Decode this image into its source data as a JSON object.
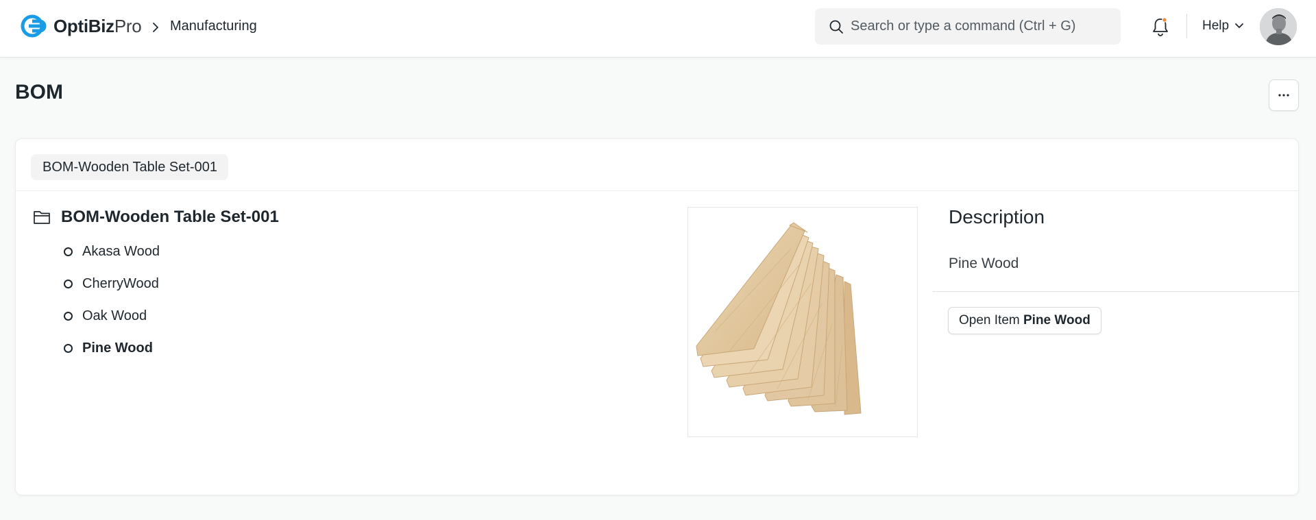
{
  "navbar": {
    "logo": {
      "brand_bold": "OptiBiz",
      "brand_light": "Pro"
    },
    "breadcrumb": {
      "label": "Manufacturing"
    },
    "search": {
      "placeholder": "Search or type a command (Ctrl + G)",
      "value": ""
    },
    "help_label": "Help"
  },
  "page": {
    "title": "BOM"
  },
  "bom": {
    "selector_label": "BOM-Wooden Table Set-001",
    "root_label": "BOM-Wooden Table Set-001",
    "items": [
      {
        "label": "Akasa Wood",
        "active": false
      },
      {
        "label": "CherryWood",
        "active": false
      },
      {
        "label": "Oak Wood",
        "active": false
      },
      {
        "label": "Pine Wood",
        "active": true
      }
    ]
  },
  "detail": {
    "description_title": "Description",
    "description_value": "Pine Wood",
    "open_prefix": "Open Item",
    "open_item": "Pine Wood"
  },
  "colors": {
    "brand_blue": "#1a9be6",
    "text": "#1f272e",
    "bell_dot": "#e98b39",
    "wood_light": "#e6cda6",
    "wood_dark": "#cfae7e"
  },
  "icons": [
    "logo-icon",
    "chevron-right-icon",
    "search-icon",
    "bell-icon",
    "chevron-down-icon",
    "avatar",
    "ellipsis-icon",
    "folder-icon",
    "circle-icon"
  ]
}
